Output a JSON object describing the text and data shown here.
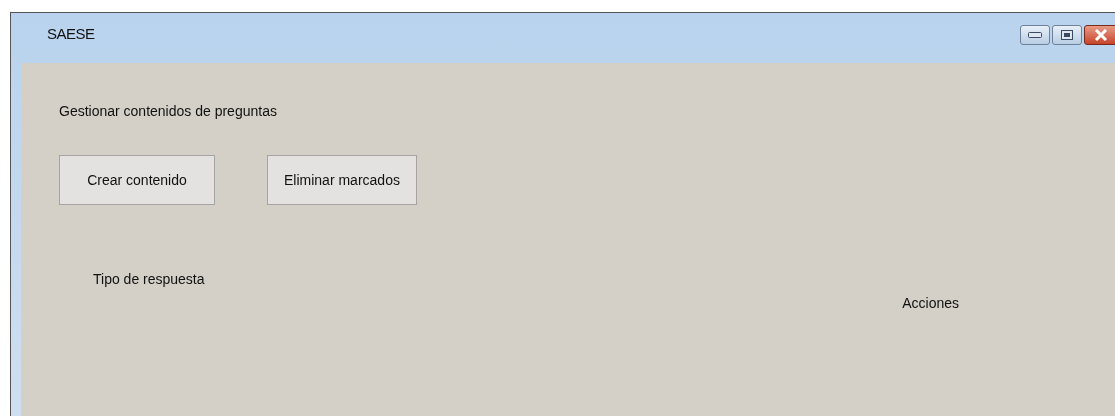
{
  "window": {
    "title": "SAESE"
  },
  "heading": "Gestionar contenidos de preguntas",
  "buttons": [
    "Crear contenido",
    "Eliminar marcados"
  ],
  "table": {
    "columns": [
      "Tipo de respuesta",
      "Acciones"
    ]
  }
}
